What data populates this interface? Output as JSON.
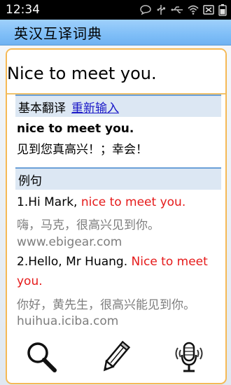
{
  "status_bar": {
    "time": "12:34"
  },
  "app": {
    "title": "英汉互译词典"
  },
  "query": {
    "text": "Nice to meet you."
  },
  "basic": {
    "header": "基本翻译",
    "re_input": "重新输入",
    "phrase": "nice to meet you.",
    "translation": "见到您真高兴！；幸会！"
  },
  "examples": {
    "header": "例句",
    "items": [
      {
        "prefix": "1.Hi Mark, ",
        "highlight": "nice to meet you.",
        "translation": "嗨，马克，很高兴见到你。",
        "source": "www.ebigear.com"
      },
      {
        "prefix": "2.Hello, Mr Huang. ",
        "highlight": "Nice to meet",
        "highlight_cont": "you.",
        "translation": "你好，黄先生，很高兴能见到你。",
        "source": "huihua.iciba.com"
      }
    ]
  },
  "toolbar": {
    "icons": [
      "search-icon",
      "pencil-icon",
      "microphone-icon"
    ]
  }
}
